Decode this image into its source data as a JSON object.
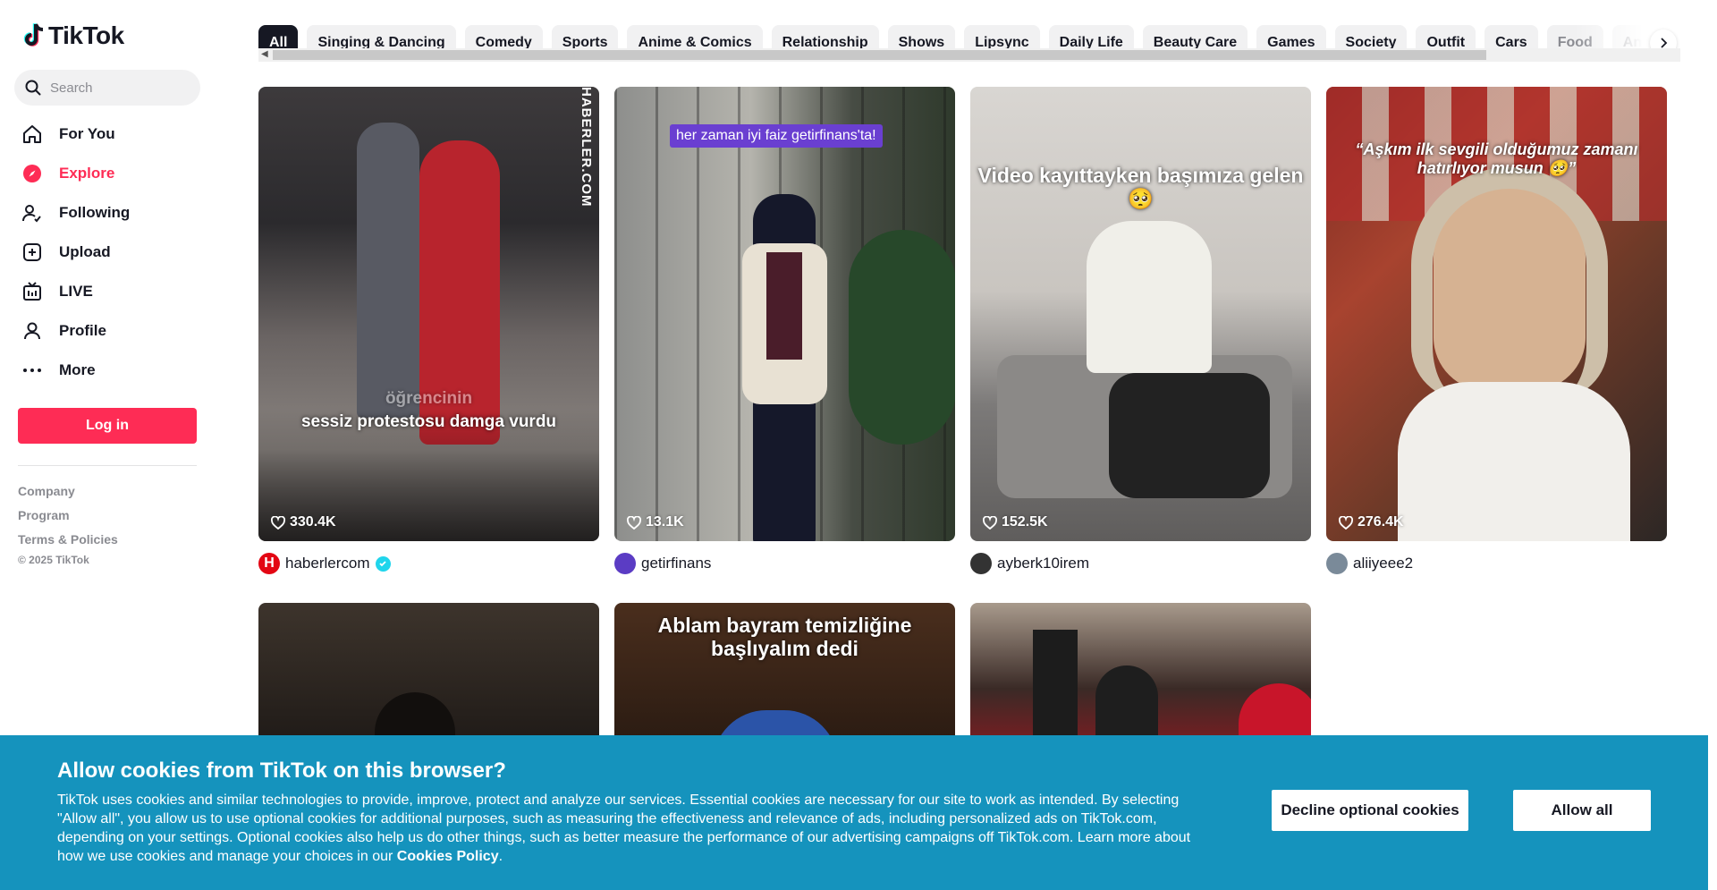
{
  "brand": {
    "name": "TikTok",
    "accent": "#fe2c55"
  },
  "search": {
    "placeholder": "Search"
  },
  "nav": [
    {
      "label": "For You",
      "icon": "home-icon"
    },
    {
      "label": "Explore",
      "icon": "compass-icon",
      "active": true
    },
    {
      "label": "Following",
      "icon": "following-icon"
    },
    {
      "label": "Upload",
      "icon": "upload-icon"
    },
    {
      "label": "LIVE",
      "icon": "live-icon"
    },
    {
      "label": "Profile",
      "icon": "profile-icon"
    },
    {
      "label": "More",
      "icon": "more-icon"
    }
  ],
  "login_label": "Log in",
  "footer": {
    "links": [
      "Company",
      "Program",
      "Terms & Policies"
    ],
    "copyright": "© 2025 TikTok"
  },
  "categories": [
    "All",
    "Singing & Dancing",
    "Comedy",
    "Sports",
    "Anime & Comics",
    "Relationship",
    "Shows",
    "Lipsync",
    "Daily Life",
    "Beauty Care",
    "Games",
    "Society",
    "Outfit",
    "Cars",
    "Food",
    "An"
  ],
  "videos": [
    {
      "likes": "330.4K",
      "author": "haberlercom",
      "verified": true,
      "caption": "sessiz protestosu damga vurdu",
      "caption_faint": "öğrencinin",
      "watermark": "HABERLER.COM"
    },
    {
      "likes": "13.1K",
      "author": "getirfinans",
      "verified": false,
      "caption": "her zaman iyi faiz getirfinans'ta!"
    },
    {
      "likes": "152.5K",
      "author": "ayberk10irem",
      "verified": false,
      "caption": "Video kayıttayken başımıza gelen 🥺"
    },
    {
      "likes": "276.4K",
      "author": "aliiyeee2",
      "verified": false,
      "caption": "“Aşkım ilk sevgili olduğumuz zamanı hatırlıyor musun 🥺”"
    },
    {
      "caption": ""
    },
    {
      "caption": "Ablam bayram temizliğine başlıyalım dedi"
    },
    {
      "caption": ""
    }
  ],
  "cookie": {
    "title": "Allow cookies from TikTok on this browser?",
    "body": "TikTok uses cookies and similar technologies to provide, improve, protect and analyze our services. Essential cookies are necessary for our site to work as intended. By selecting \"Allow all\", you allow us to use optional cookies for additional purposes, such as measuring the effectiveness and relevance of ads, including personalized ads on TikTok.com, depending on your settings. Optional cookies also help us do other things, such as better measure the performance of our advertising campaigns off TikTok.com. Learn more about how we use cookies and manage your choices in our ",
    "policy_link": "Cookies Policy",
    "decline_label": "Decline optional cookies",
    "allow_label": "Allow all",
    "bg_color": "#1593bd"
  }
}
